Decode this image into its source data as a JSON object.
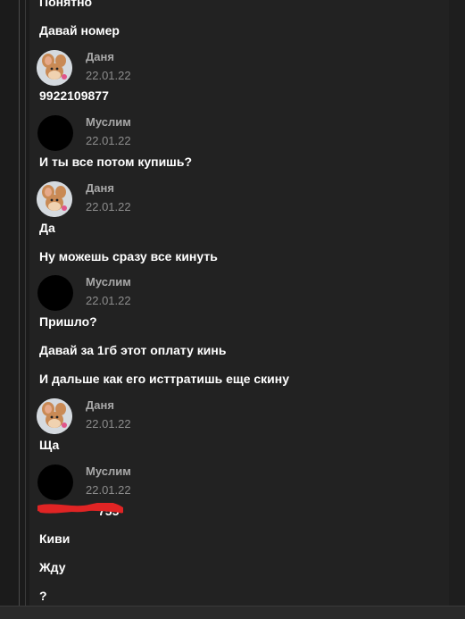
{
  "messages_top": [
    {
      "text": "Понятно"
    },
    {
      "text": "Давай номер"
    }
  ],
  "blocks": [
    {
      "author": "Даня",
      "date": "22.01.22",
      "avatar": "jerry-mouse-avatar",
      "lines": [
        "9922109877"
      ]
    },
    {
      "author": "Муслим",
      "date": "22.01.22",
      "avatar": "black-avatar",
      "lines": [
        "И ты все потом купишь?"
      ]
    },
    {
      "author": "Даня",
      "date": "22.01.22",
      "avatar": "jerry-mouse-avatar",
      "lines": [
        "Да",
        "Ну можешь сразу все кинуть"
      ]
    },
    {
      "author": "Муслим",
      "date": "22.01.22",
      "avatar": "black-avatar",
      "lines": [
        "Пришло?",
        "Давай за 1гб этот оплату кинь",
        "И дальше как его исттратишь еще скину"
      ]
    },
    {
      "author": "Даня",
      "date": "22.01.22",
      "avatar": "jerry-mouse-avatar",
      "lines": [
        "Ща"
      ]
    },
    {
      "author": "Муслим",
      "date": "22.01.22",
      "avatar": "black-avatar",
      "lines": [
        "755",
        "Киви",
        "Жду",
        "?"
      ]
    }
  ],
  "colors": {
    "background": "#1b1b1b",
    "panel": "#222222",
    "text": "#ffffff",
    "author": "#a8a8a8",
    "date": "#8c8c8c",
    "redaction": "#e02424"
  }
}
